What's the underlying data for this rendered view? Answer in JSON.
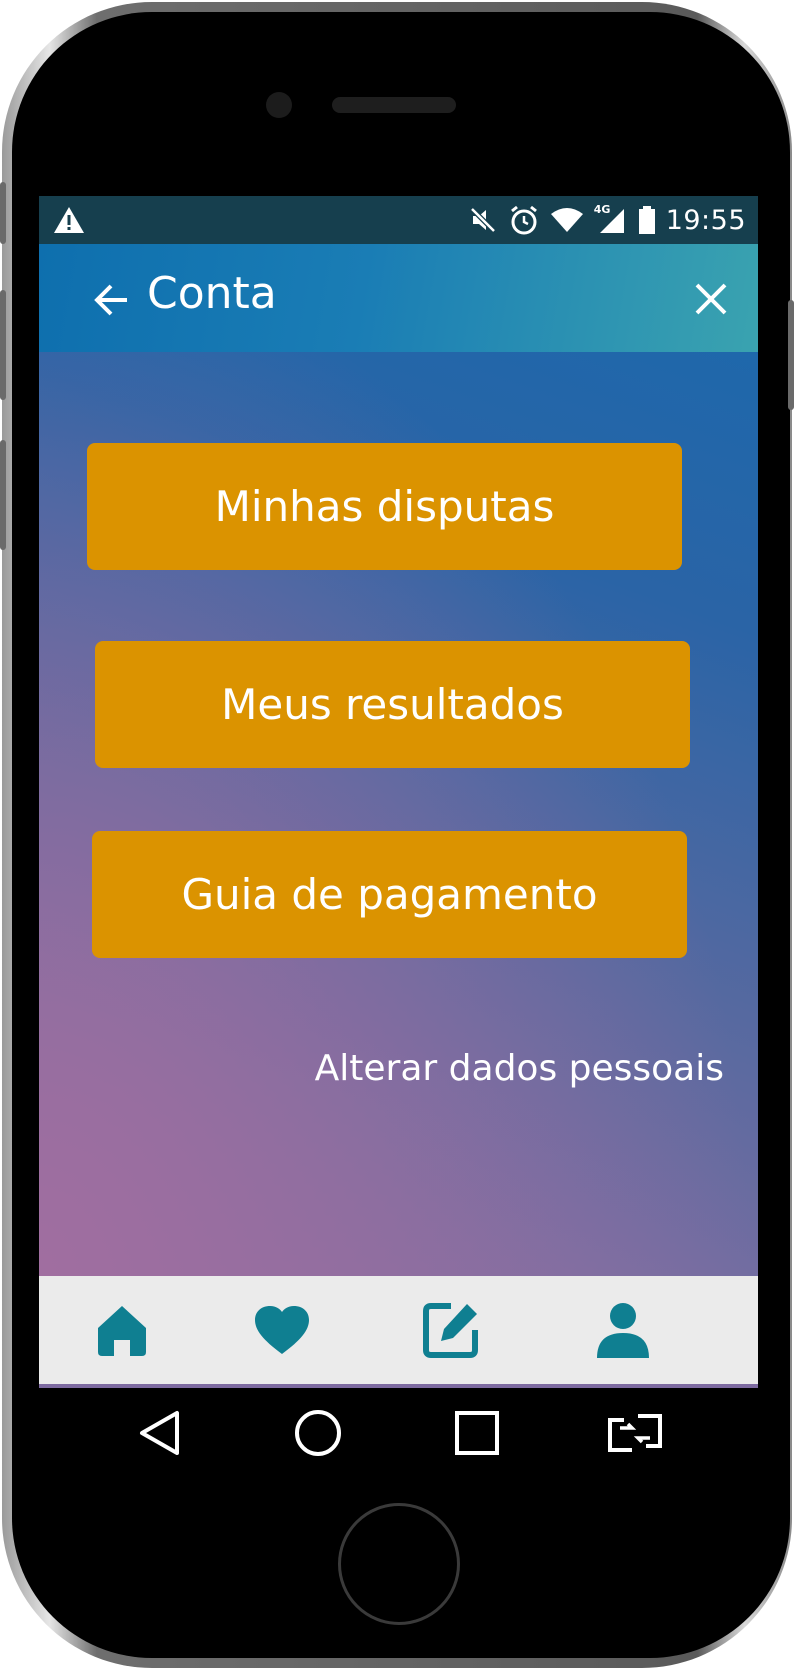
{
  "status_bar": {
    "time": "19:55",
    "network_label": "4G",
    "icons": [
      "warning-icon",
      "mute-icon",
      "alarm-icon",
      "wifi-icon",
      "signal-icon",
      "battery-icon"
    ]
  },
  "app_bar": {
    "title": "Conta",
    "back_icon": "arrow-left-icon",
    "close_icon": "close-icon"
  },
  "menu": {
    "buttons": [
      {
        "label": "Minhas disputas"
      },
      {
        "label": "Meus resultados"
      },
      {
        "label": "Guia de pagamento"
      }
    ],
    "personal_link": "Alterar dados pessoais"
  },
  "bottom_nav": {
    "items": [
      {
        "icon": "home-icon"
      },
      {
        "icon": "heart-icon"
      },
      {
        "icon": "edit-icon"
      },
      {
        "icon": "user-icon"
      }
    ]
  },
  "system_nav": {
    "items": [
      "back-triangle-icon",
      "home-circle-icon",
      "recents-square-icon",
      "switch-apps-icon"
    ]
  },
  "colors": {
    "accent_button": "#db9300",
    "status_bar": "#163f4e",
    "nav_icon": "#0f7f91",
    "bottom_nav_bg": "#ebebeb"
  }
}
